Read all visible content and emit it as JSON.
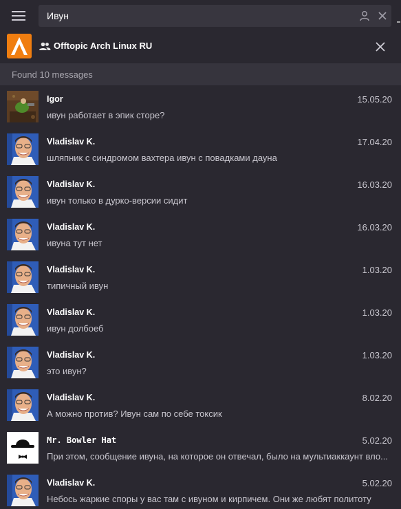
{
  "search": {
    "value": "Ивун",
    "placeholder": ""
  },
  "chat": {
    "title": "Offtopic Arch Linux RU",
    "logo_letter": "A"
  },
  "found_label": "Found 10 messages",
  "icons": {
    "menu": "hamburger-menu-icon",
    "user_filter": "person-icon",
    "clear": "close-icon",
    "group": "group-icon",
    "close_chat": "close-icon"
  },
  "colors": {
    "background": "#2a2830",
    "search_field": "#38363f",
    "found_bar": "#36343d",
    "accent_orange": "#f07e10"
  },
  "results": [
    {
      "name": "Igor",
      "date": "15.05.20",
      "text": "ивун работает в эпик сторе?",
      "avatar": "game-avatar"
    },
    {
      "name": "Vladislav K.",
      "date": "17.04.20",
      "text": "шляпник с синдромом вахтера ивун с повадками дауна",
      "avatar": "photo-avatar"
    },
    {
      "name": "Vladislav K.",
      "date": "16.03.20",
      "text": "ивун только в дурко-версии сидит",
      "avatar": "photo-avatar"
    },
    {
      "name": "Vladislav K.",
      "date": "16.03.20",
      "text": "ивуна тут нет",
      "avatar": "photo-avatar"
    },
    {
      "name": "Vladislav K.",
      "date": "1.03.20",
      "text": "типичный ивун",
      "avatar": "photo-avatar"
    },
    {
      "name": "Vladislav K.",
      "date": "1.03.20",
      "text": "ивун долбоеб",
      "avatar": "photo-avatar"
    },
    {
      "name": "Vladislav K.",
      "date": "1.03.20",
      "text": "это ивун?",
      "avatar": "photo-avatar"
    },
    {
      "name": "Vladislav K.",
      "date": "8.02.20",
      "text": "А можно против? Ивун сам по себе токсик",
      "avatar": "photo-avatar"
    },
    {
      "name": "Mr. Bowler Hat",
      "date": "5.02.20",
      "text": "При этом, сообщение ивуна, на которое он отвечал, было на мультиаккаунт вло...",
      "avatar": "bowler-hat-avatar"
    },
    {
      "name": "Vladislav K.",
      "date": "5.02.20",
      "text": "Небось жаркие споры у вас там с ивуном и кирпичем. Они же любят политоту",
      "avatar": "photo-avatar"
    }
  ]
}
